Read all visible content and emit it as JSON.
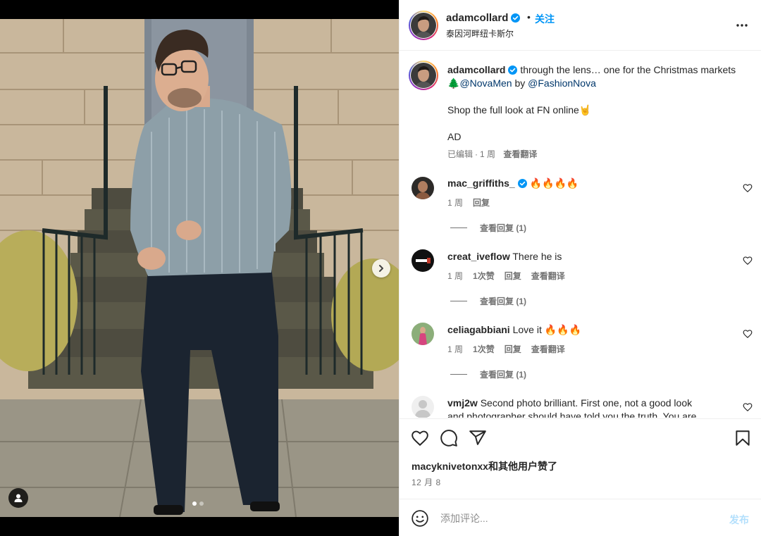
{
  "post": {
    "author": "adamcollard",
    "verified": true,
    "separator": "•",
    "follow_label": "关注",
    "location": "泰因河畔纽卡斯尔",
    "more_icon": "more-horizontal-icon"
  },
  "caption": {
    "author": "adamcollard",
    "text_1": "through the lens… one for the Christmas markets 🌲",
    "mention_1": "@NovaMen",
    "by": "by",
    "mention_2": "@FashionNova",
    "shop_line": "Shop the full look at FN online🤘",
    "ad_line": "AD",
    "edited": "已编辑",
    "dot": "·",
    "age": "1 周",
    "translate": "查看翻译"
  },
  "comments": [
    {
      "user": "mac_griffiths_",
      "verified": true,
      "text": "🔥🔥🔥🔥",
      "age": "1 周",
      "likes": "",
      "reply": "回复",
      "translate": "",
      "view_replies": "查看回复 (1)"
    },
    {
      "user": "creat_iveflow",
      "verified": false,
      "text": "There he is",
      "age": "1 周",
      "likes": "1次赞",
      "reply": "回复",
      "translate": "查看翻译",
      "view_replies": "查看回复 (1)"
    },
    {
      "user": "celiagabbiani",
      "verified": false,
      "text": "Love it 🔥🔥🔥",
      "age": "1 周",
      "likes": "1次赞",
      "reply": "回复",
      "translate": "查看翻译",
      "view_replies": "查看回复 (1)"
    },
    {
      "user": "vmj2w",
      "verified": false,
      "text": "Second photo brilliant. First one, not a good look",
      "text_2": "and photographer should have told you the truth. You are"
    }
  ],
  "action_bar": {
    "like_icon": "heart-icon",
    "comment_icon": "comment-icon",
    "share_icon": "send-icon",
    "save_icon": "bookmark-icon",
    "likes_user": "macyknivetonxx",
    "likes_suffix": "和其他用户赞了",
    "date": "12 月 8"
  },
  "composer": {
    "emoji_icon": "emoji-smile-icon",
    "placeholder": "添加评论...",
    "post_label": "发布"
  },
  "media": {
    "carousel_index": 1,
    "carousel_total": 2,
    "next_icon": "chevron-right-icon",
    "tag_icon": "user-tag-icon"
  },
  "colors": {
    "accent": "#0095f6",
    "link": "#00376b",
    "muted": "#737373",
    "divider": "#efefef"
  }
}
